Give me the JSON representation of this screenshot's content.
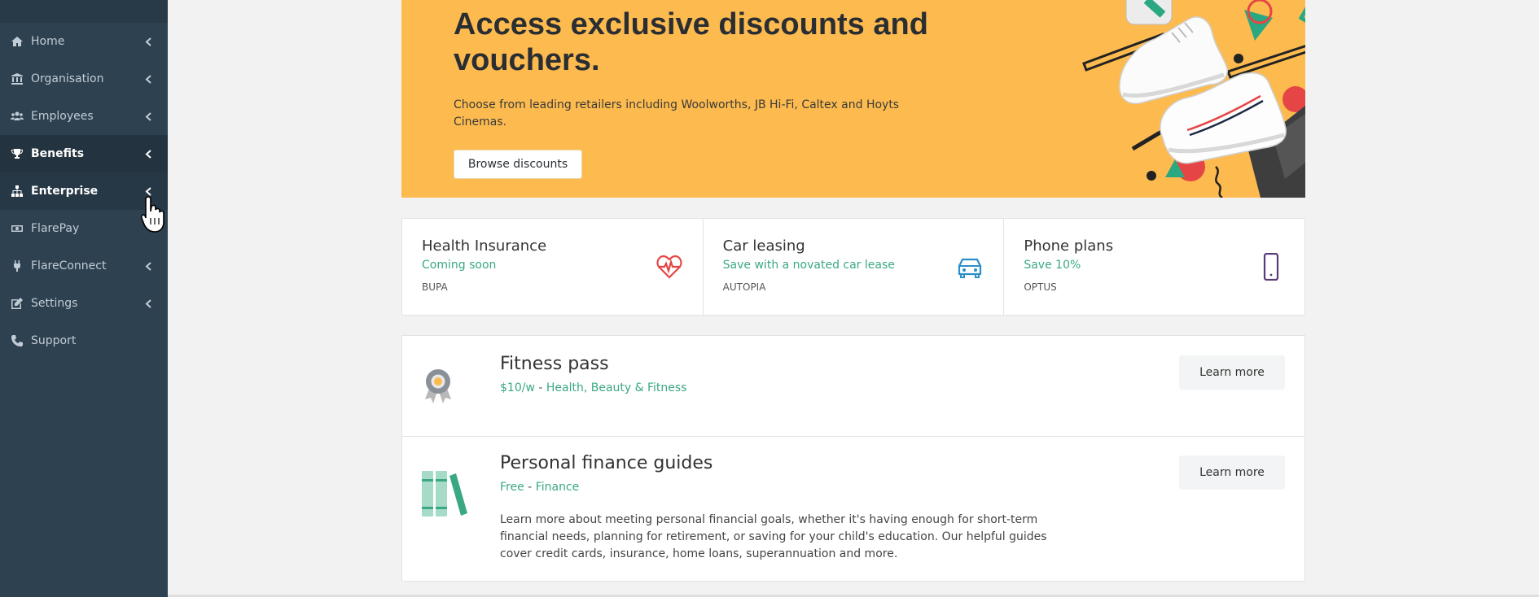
{
  "sidebar": {
    "items": [
      {
        "label": "Home",
        "icon": "home-icon",
        "chevron": true
      },
      {
        "label": "Organisation",
        "icon": "bank-icon",
        "chevron": true
      },
      {
        "label": "Employees",
        "icon": "users-icon",
        "chevron": true
      },
      {
        "label": "Benefits",
        "icon": "trophy-icon",
        "chevron": true
      },
      {
        "label": "Enterprise",
        "icon": "sitemap-icon",
        "chevron": true
      },
      {
        "label": "FlarePay",
        "icon": "money-icon",
        "chevron": false
      },
      {
        "label": "FlareConnect",
        "icon": "plug-icon",
        "chevron": true
      },
      {
        "label": "Settings",
        "icon": "edit-icon",
        "chevron": true
      },
      {
        "label": "Support",
        "icon": "phone-icon",
        "chevron": false
      }
    ]
  },
  "hero": {
    "title": "Access exclusive discounts and vouchers.",
    "text": "Choose from leading retailers including Woolworths, JB Hi-Fi, Caltex and Hoyts Cinemas.",
    "button": "Browse discounts"
  },
  "cards": [
    {
      "title": "Health Insurance",
      "subtitle": "Coming soon",
      "brand": "BUPA",
      "icon": "heartbeat-icon"
    },
    {
      "title": "Car leasing",
      "subtitle": "Save with a novated car lease",
      "brand": "AUTOPIA",
      "icon": "car-icon"
    },
    {
      "title": "Phone plans",
      "subtitle": "Save 10%",
      "brand": "OPTUS",
      "icon": "mobile-phone-icon"
    }
  ],
  "benefits": [
    {
      "title": "Fitness pass",
      "price": "$10/w",
      "separator": "-",
      "category": "Health, Beauty & Fitness",
      "button": "Learn more",
      "icon": "award-ribbon-icon"
    },
    {
      "title": "Personal finance guides",
      "price": "Free",
      "separator": "-",
      "category": "Finance",
      "description": "Learn more about meeting personal financial goals, whether it's having enough for short-term financial needs, planning for retirement, or saving for your child's education. Our helpful guides cover credit cards, insurance, home loans, superannuation and more.",
      "button": "Learn more",
      "icon": "books-icon"
    }
  ],
  "colors": {
    "sidebar": "#2e4151",
    "hero": "#fdbb4f",
    "accent_green": "#3aa882",
    "heart_red": "#e64545",
    "car_blue": "#2a8fc9",
    "phone_purple": "#5a3a78"
  }
}
